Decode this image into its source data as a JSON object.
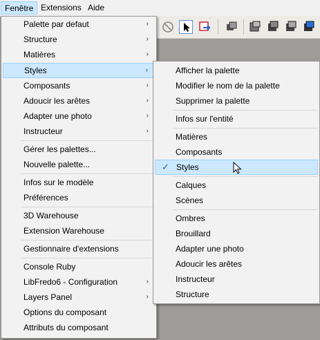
{
  "menubar": {
    "items": [
      {
        "label": "Fenêtre"
      },
      {
        "label": "Extensions"
      },
      {
        "label": "Aide"
      }
    ]
  },
  "window_menu": {
    "items": [
      {
        "label": "Palette par defaut",
        "submenu": true
      },
      {
        "label": "Structure",
        "submenu": true
      },
      {
        "label": "Matières",
        "submenu": true
      },
      {
        "label": "Styles",
        "submenu": true,
        "highlighted": true
      },
      {
        "label": "Composants",
        "submenu": true
      },
      {
        "label": "Adoucir les arêtes",
        "submenu": true
      },
      {
        "label": "Adapter une photo",
        "submenu": true
      },
      {
        "label": "Instructeur",
        "submenu": true
      },
      {
        "label": "Gérer les palettes..."
      },
      {
        "label": "Nouvelle palette..."
      },
      {
        "label": "Infos sur le modèle"
      },
      {
        "label": "Préférences"
      },
      {
        "label": "3D Warehouse"
      },
      {
        "label": "Extension Warehouse"
      },
      {
        "label": "Gestionnaire d'extensions"
      },
      {
        "label": "Console Ruby"
      },
      {
        "label": "LibFredo6 - Configuration",
        "submenu": true
      },
      {
        "label": "Layers Panel",
        "submenu": true
      },
      {
        "label": "Options du composant"
      },
      {
        "label": "Attributs du composant"
      }
    ]
  },
  "styles_submenu": {
    "items": [
      {
        "label": "Afficher la palette"
      },
      {
        "label": "Modifier le nom de la palette"
      },
      {
        "label": "Supprimer la palette"
      },
      {
        "label": "Infos sur l'entité"
      },
      {
        "label": "Matières"
      },
      {
        "label": "Composants"
      },
      {
        "label": "Styles",
        "checked": true,
        "hovered": true
      },
      {
        "label": "Calques"
      },
      {
        "label": "Scènes"
      },
      {
        "label": "Ombres"
      },
      {
        "label": "Brouillard"
      },
      {
        "label": "Adapter une photo"
      },
      {
        "label": "Adoucir les arêtes"
      },
      {
        "label": "Instructeur"
      },
      {
        "label": "Structure"
      }
    ]
  },
  "glyphs": {
    "submenu_arrow": "›",
    "check": "✓"
  },
  "colors": {
    "highlight": "#cce8ff",
    "highlight_border": "#99d1ff",
    "menu_bg": "#f2f2f2"
  }
}
